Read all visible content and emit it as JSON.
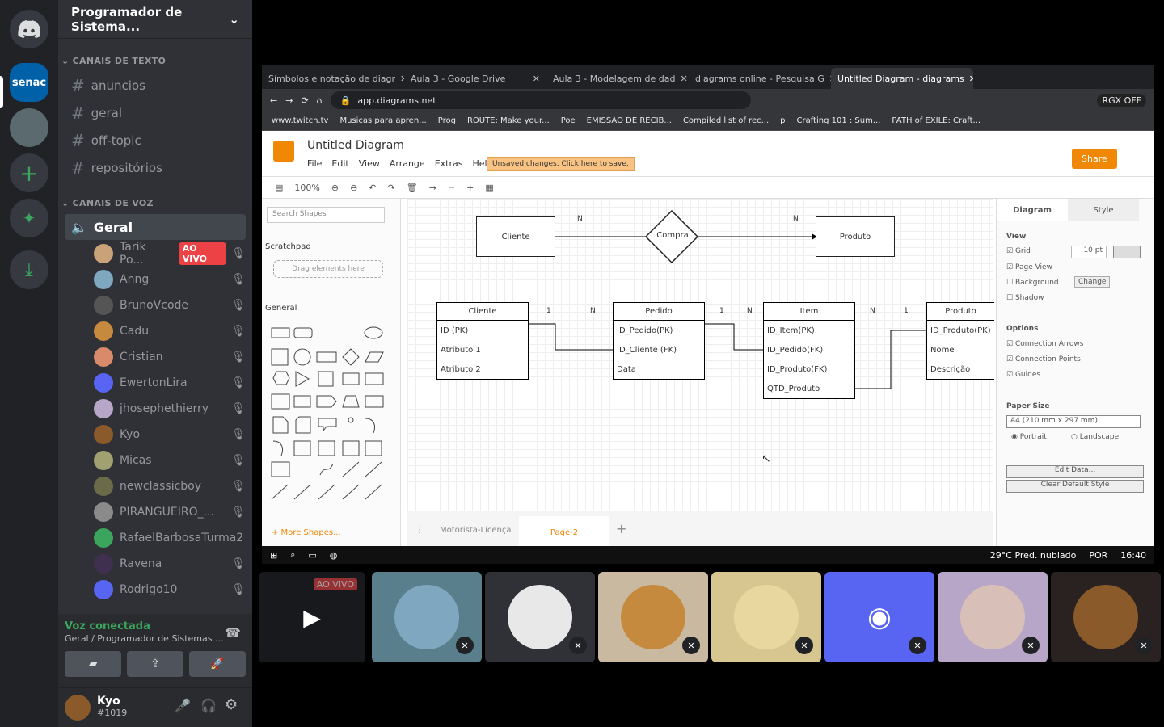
{
  "server_name": "Programador de Sistema...",
  "text_category": "CANAIS DE TEXTO",
  "voice_category": "CANAIS DE VOZ",
  "text_channels": [
    "anuncios",
    "geral",
    "off-topic",
    "repositórios"
  ],
  "voice_channel": "Geral",
  "live_badge": "AO VIVO",
  "voice_users": [
    {
      "name": "Tarik Po...",
      "color": "#c9a27a"
    },
    {
      "name": "Anng",
      "color": "#7fa7c0"
    },
    {
      "name": "BrunoVcode",
      "color": "#555"
    },
    {
      "name": "Cadu",
      "color": "#c68a3e"
    },
    {
      "name": "Cristian",
      "color": "#d88a6a"
    },
    {
      "name": "EwertonLira",
      "color": "#5865f2"
    },
    {
      "name": "jhosephethierry",
      "color": "#b8a6c8"
    },
    {
      "name": "Kyo",
      "color": "#8a5a2a"
    },
    {
      "name": "Micas",
      "color": "#a0a070"
    },
    {
      "name": "newclassicboy",
      "color": "#6b6b4a"
    },
    {
      "name": "PIRANGUEIRO_...",
      "color": "#8a8a8a"
    },
    {
      "name": "RafaelBarbosaTurma2",
      "color": "#3ba55d"
    },
    {
      "name": "Ravena",
      "color": "#403050"
    },
    {
      "name": "Rodrigo10",
      "color": "#5865f2"
    }
  ],
  "voice_status": "Voz conectada",
  "voice_location": "Geral / Programador de Sistemas ...",
  "username": "Kyo",
  "discriminator": "#1019",
  "browser": {
    "tabs": [
      "Símbolos e notação de diagr",
      "Aula 3 - Google Drive",
      "Aula 3 - Modelagem de dad",
      "diagrams online - Pesquisa G",
      "Untitled Diagram - diagrams"
    ],
    "url": "app.diagrams.net",
    "rgx": "RGX OFF",
    "bookmarks": [
      "www.twitch.tv",
      "Musicas para apren...",
      "Prog",
      "ROUTE: Make your...",
      "Poe",
      "EMISSÃO DE RECIB...",
      "Compiled list of rec...",
      "p",
      "Crafting 101 : Sum...",
      "PATH of EXILE: Craft..."
    ]
  },
  "drawio": {
    "title": "Untitled Diagram",
    "menu": [
      "File",
      "Edit",
      "View",
      "Arrange",
      "Extras",
      "Help"
    ],
    "unsaved": "Unsaved changes. Click here to save.",
    "share": "Share",
    "zoom": "100%",
    "search_placeholder": "Search Shapes",
    "scratchpad": "Scratchpad",
    "drag_here": "Drag elements here",
    "general": "General",
    "more_shapes": "+ More Shapes...",
    "pages": [
      "Motorista-Licença",
      "Page-2"
    ],
    "panel": {
      "tabs": [
        "Diagram",
        "Style"
      ],
      "view": "View",
      "grid": "Grid",
      "grid_size": "10 pt",
      "page_view": "Page View",
      "background": "Background",
      "change": "Change",
      "shadow": "Shadow",
      "options": "Options",
      "connection_arrows": "Connection Arrows",
      "connection_points": "Connection Points",
      "guides": "Guides",
      "paper_size": "Paper Size",
      "paper_value": "A4 (210 mm x 297 mm)",
      "portrait": "Portrait",
      "landscape": "Landscape",
      "edit_data": "Edit Data...",
      "clear_style": "Clear Default Style"
    },
    "top_diagram": {
      "left": "Cliente",
      "rel": "Compra",
      "right": "Produto",
      "n1": "N",
      "n2": "N"
    },
    "entities": [
      {
        "name": "Cliente",
        "rows": [
          "ID (PK)",
          "Atributo 1",
          "Atributo 2"
        ]
      },
      {
        "name": "Pedido",
        "rows": [
          "ID_Pedido(PK)",
          "ID_Cliente (FK)",
          "Data"
        ]
      },
      {
        "name": "Item",
        "rows": [
          "ID_Item(PK)",
          "ID_Pedido(FK)",
          "ID_Produto(FK)",
          "QTD_Produto"
        ]
      },
      {
        "name": "Produto",
        "rows": [
          "ID_Produto(PK)",
          "Nome",
          "Descrição"
        ]
      }
    ],
    "card_labels": [
      "1",
      "N",
      "1",
      "N",
      "N",
      "1"
    ]
  },
  "taskbar": {
    "weather": "29°C  Pred. nublado",
    "lang": "POR",
    "time": "16:40"
  },
  "stream_live": "AO VIVO"
}
